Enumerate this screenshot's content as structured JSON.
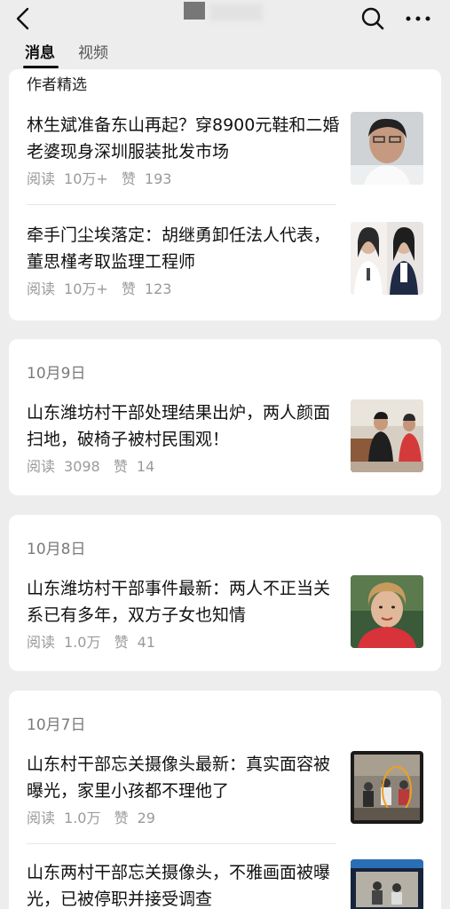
{
  "tabs": {
    "messages": "消息",
    "video": "视频"
  },
  "sections": {
    "picks_label": "作者精选",
    "date_oct9": "10月9日",
    "date_oct8": "10月8日",
    "date_oct7": "10月7日"
  },
  "articles": [
    {
      "title": "林生斌准备东山再起？穿8900元鞋和二婚老婆现身深圳服装批发市场",
      "read_label": "阅读",
      "reads": "10万+",
      "like_label": "赞",
      "likes": "193",
      "thumb": "man-portrait"
    },
    {
      "title": "牵手门尘埃落定：胡继勇卸任法人代表，董思槿考取监理工程师",
      "read_label": "阅读",
      "reads": "10万+",
      "like_label": "赞",
      "likes": "123",
      "thumb": "two-women-speaking"
    },
    {
      "title": "山东潍坊村干部处理结果出炉，两人颜面扫地，破椅子被村民围观！",
      "read_label": "阅读",
      "reads": "3098",
      "like_label": "赞",
      "likes": "14",
      "thumb": "office-meeting"
    },
    {
      "title": "山东潍坊村干部事件最新：两人不正当关系已有多年，双方子女也知情",
      "read_label": "阅读",
      "reads": "1.0万",
      "like_label": "赞",
      "likes": "41",
      "thumb": "woman-portrait"
    },
    {
      "title": "山东村干部忘关摄像头最新：真实面容被曝光，家里小孩都不理他了",
      "read_label": "阅读",
      "reads": "1.0万",
      "like_label": "赞",
      "likes": "29",
      "thumb": "surveillance-room"
    },
    {
      "title": "山东两村干部忘关摄像头，不雅画面被曝光，已被停职并接受调查",
      "thumb": "news-screen"
    }
  ]
}
